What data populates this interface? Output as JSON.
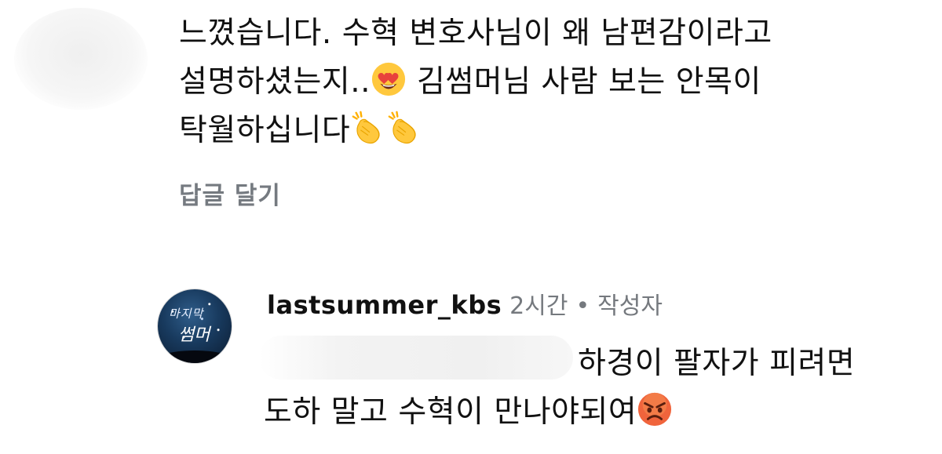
{
  "comment": {
    "lines": [
      "느꼈습니다. 수혁 변호사님이 왜 남편감이라고",
      "설명하셨는지..",
      " 김썸머님 사람 보는 안목이",
      "탁월하십니다"
    ],
    "emojis": [
      "heart-eyes-emoji",
      "clapping-hands-emoji",
      "clapping-hands-emoji"
    ],
    "reply_label": "답글 달기"
  },
  "reply": {
    "avatar_text_top": "마지막",
    "avatar_text_bottom": "썸머",
    "username": "lastsummer_kbs",
    "time": "2시간",
    "separator": "•",
    "author_badge": "작성자",
    "text_line1": "하경이 팔자가 피려면",
    "text_line2": "도하 말고 수혁이 만나야되여",
    "emoji": "angry-face-emoji"
  },
  "colors": {
    "text": "#111111",
    "muted": "#757a80",
    "emoji_yellow": "#ffc83d",
    "emoji_red": "#e8423c"
  }
}
